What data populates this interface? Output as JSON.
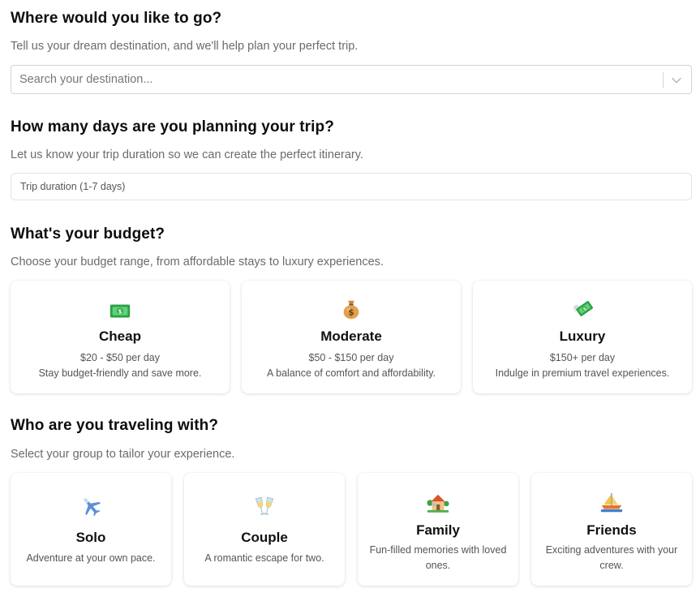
{
  "destination": {
    "title": "Where would you like to go?",
    "description": "Tell us your dream destination, and we'll help plan your perfect trip.",
    "placeholder": "Search your destination..."
  },
  "duration": {
    "title": "How many days are you planning your trip?",
    "description": "Let us know your trip duration so we can create the perfect itinerary.",
    "placeholder": "Trip duration (1-7 days)"
  },
  "budget": {
    "title": "What's your budget?",
    "description": "Choose your budget range, from affordable stays to luxury experiences.",
    "options": [
      {
        "icon": "dollar-banknote-icon",
        "title": "Cheap",
        "range": "$20 - $50 per day",
        "desc": "Stay budget-friendly and save more."
      },
      {
        "icon": "money-bag-icon",
        "title": "Moderate",
        "range": "$50 - $150 per day",
        "desc": "A balance of comfort and affordability."
      },
      {
        "icon": "money-with-wings-icon",
        "title": "Luxury",
        "range": "$150+ per day",
        "desc": "Indulge in premium travel experiences."
      }
    ]
  },
  "travelers": {
    "title": "Who are you traveling with?",
    "description": "Select your group to tailor your experience.",
    "options": [
      {
        "icon": "airplane-icon",
        "title": "Solo",
        "desc": "Adventure at your own pace."
      },
      {
        "icon": "clinking-glasses-icon",
        "title": "Couple",
        "desc": "A romantic escape for two."
      },
      {
        "icon": "house-with-garden-icon",
        "title": "Family",
        "desc": "Fun-filled memories with loved ones."
      },
      {
        "icon": "sailboat-icon",
        "title": "Friends",
        "desc": "Exciting adventures with your crew."
      }
    ]
  },
  "colors": {
    "text": "#0d0d0d",
    "muted": "#6b6b6b",
    "border": "#d4d4d4"
  }
}
